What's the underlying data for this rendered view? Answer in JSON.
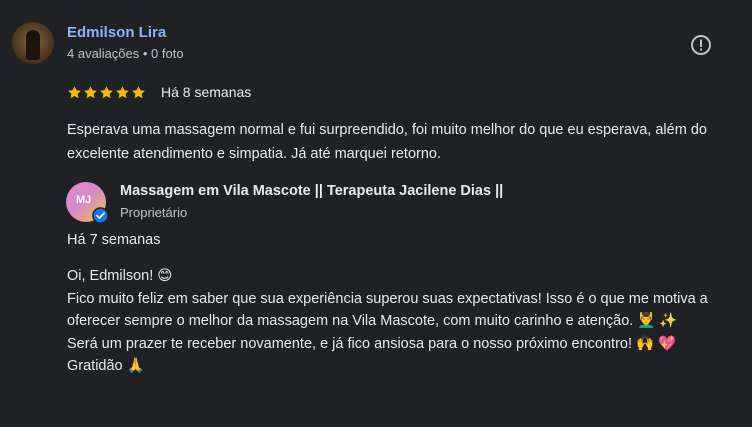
{
  "reviewer": {
    "name": "Edmilson Lira",
    "meta": "4 avaliações • 0 foto"
  },
  "review": {
    "rating": 5,
    "date": "Há 8 semanas",
    "text": "Esperava uma massagem normal e fui surpreendido, foi muito melhor do que eu esperava, além do excelente atendimento e simpatia. Já até marquei retorno."
  },
  "owner": {
    "name": "Massagem em Vila Mascote || Terapeuta Jacilene Dias ||",
    "role": "Proprietário",
    "avatar_text": "MJ"
  },
  "response": {
    "date": "Há 7 semanas",
    "lines": [
      "Oi, Edmilson! 😊",
      "Fico muito feliz em saber que sua experiência superou suas expectativas! Isso é o que me motiva a oferecer sempre o melhor da massagem na Vila Mascote, com muito carinho e atenção. 💆‍♂️ ✨",
      "Será um prazer te receber novamente, e já fico ansiosa para o nosso próximo encontro! 🙌 💖",
      "Gratidão 🙏"
    ]
  },
  "colors": {
    "background": "#202124",
    "name_link": "#8ab4f8",
    "star": "#fbbc04",
    "verified": "#1a73e8"
  },
  "icons": [
    "report-icon",
    "star-icon",
    "verified-badge-icon"
  ]
}
